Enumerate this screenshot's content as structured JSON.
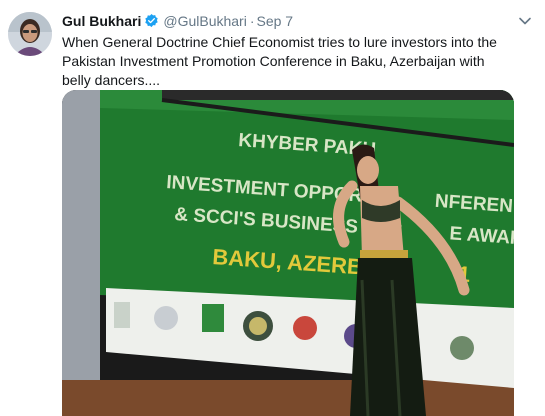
{
  "tweet": {
    "author_name": "Gul Bukhari",
    "handle": "@GulBukhari",
    "separator": "·",
    "date": "Sep 7",
    "text": "When General Doctrine Chief Economist tries to lure investors into the Pakistan Investment Promotion Conference in Baku, Azerbaijan with belly dancers....",
    "verified_badge": "verified-check-icon",
    "menu_icon": "chevron-down-icon"
  },
  "media": {
    "banner_lines": [
      "KHYBER PAKH",
      "INVESTMENT OPPORTU         NFEREN",
      "& SCCI'S BUSINESS EXC         E AWAR",
      "BAKU, AZERBAI            1"
    ]
  },
  "colors": {
    "verified": "#1da1f2",
    "banner_green": "#1f7a2e",
    "banner_text": "#d8e6c6",
    "banner_yellow": "#e2c93b"
  }
}
